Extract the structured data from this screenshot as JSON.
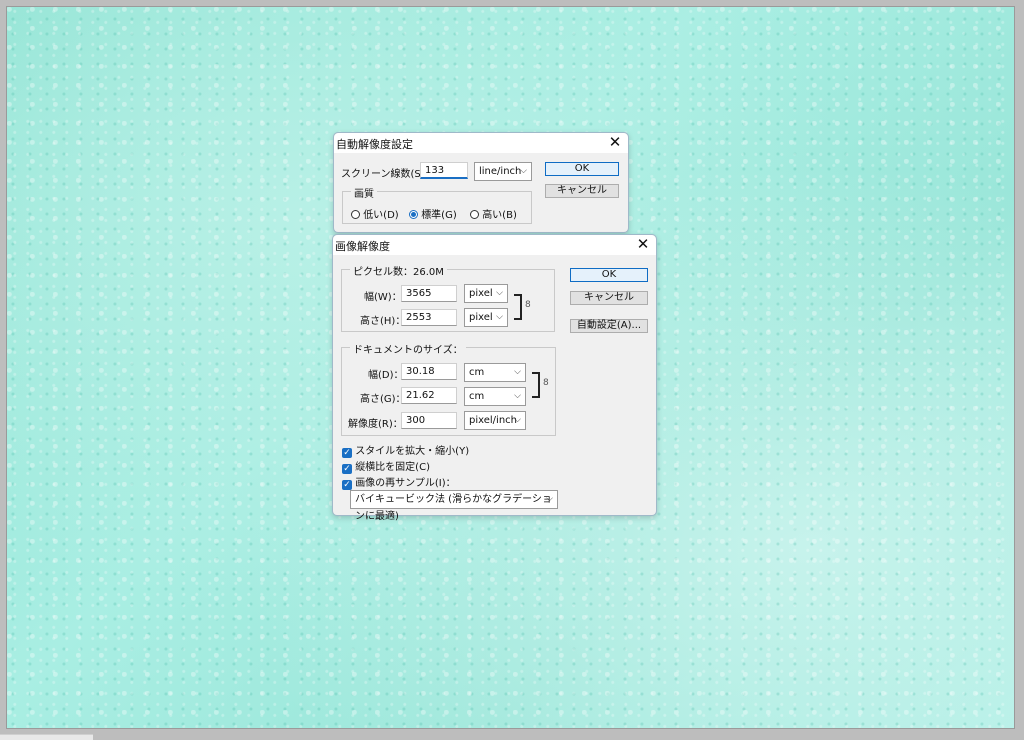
{
  "dialog_auto": {
    "title": "自動解像度設定",
    "close": "✕",
    "screen_label": "スクリーン線数(S)：",
    "screen_value": "133",
    "screen_unit": "line/inch",
    "ok": "OK",
    "cancel": "キャンセル",
    "quality_legend": "画質",
    "quality_low": "低い(D)",
    "quality_std": "標準(G)",
    "quality_high": "高い(B)",
    "quality_selected": "標準(G)"
  },
  "dialog_resize": {
    "title": "画像解像度",
    "close": "✕",
    "pixels_legend": "ピクセル数：26.0M",
    "width_label": "幅(W)：",
    "width_value": "3565",
    "width_unit": "pixel",
    "height_label": "高さ(H)：",
    "height_value": "2553",
    "height_unit": "pixel",
    "doc_legend": "ドキュメントのサイズ：",
    "doc_width_label": "幅(D)：",
    "doc_width_value": "30.18",
    "doc_width_unit": "cm",
    "doc_height_label": "高さ(G)：",
    "doc_height_value": "21.62",
    "doc_height_unit": "cm",
    "resolution_label": "解像度(R)：",
    "resolution_value": "300",
    "resolution_unit": "pixel/inch",
    "ok": "OK",
    "cancel": "キャンセル",
    "auto": "自動設定(A)...",
    "scale_styles": "スタイルを拡大・縮小(Y)",
    "constrain": "縦横比を固定(C)",
    "resample": "画像の再サンプル(I)：",
    "resample_method": "バイキュービック法 (滑らかなグラデーションに最適)"
  },
  "icons": {
    "chevron": "⌵",
    "check": "✓",
    "link": "8"
  },
  "colors": {
    "accent": "#1a6fc4",
    "canvas": "#a9eee3"
  }
}
